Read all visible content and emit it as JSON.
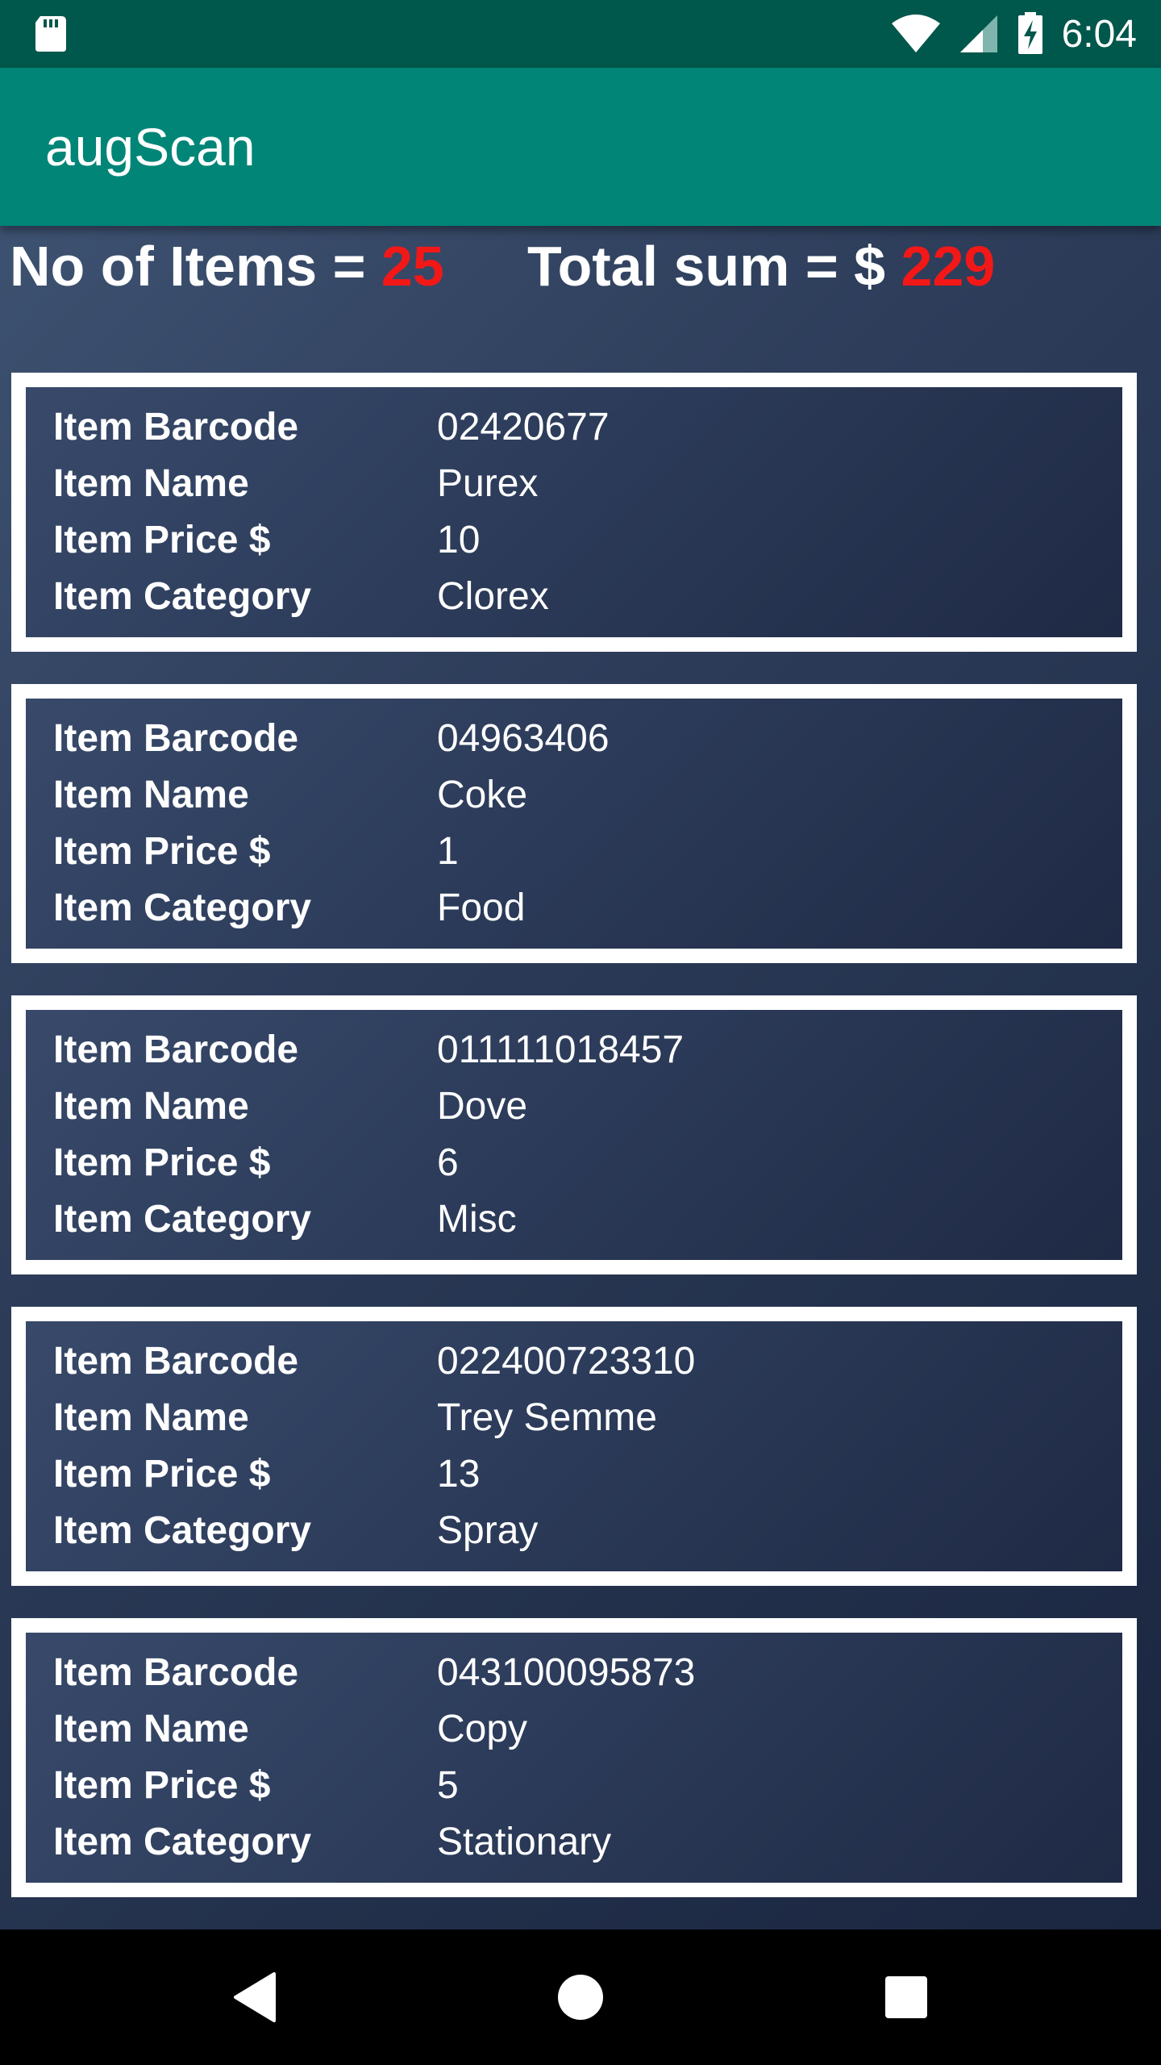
{
  "status_bar": {
    "time": "6:04",
    "icons": [
      "sd-card-icon",
      "wifi-icon",
      "cell-signal-icon",
      "battery-charging-icon"
    ]
  },
  "app_bar": {
    "title": "augScan"
  },
  "summary": {
    "items_label": "No of Items = ",
    "items_count": "25",
    "total_label": "Total sum = $ ",
    "total_value": "229"
  },
  "items": [
    {
      "barcode_label": "Item Barcode",
      "barcode": "02420677",
      "name_label": "Item Name",
      "name": "Purex",
      "price_label": "Item Price $",
      "price": "10",
      "category_label": "Item Category",
      "category": "Clorex"
    },
    {
      "barcode_label": "Item Barcode",
      "barcode": "04963406",
      "name_label": "Item Name",
      "name": "Coke",
      "price_label": "Item Price $",
      "price": "1",
      "category_label": "Item Category",
      "category": "Food"
    },
    {
      "barcode_label": "Item Barcode",
      "barcode": "011111018457",
      "name_label": "Item Name",
      "name": "Dove",
      "price_label": "Item Price $",
      "price": "6",
      "category_label": "Item Category",
      "category": "Misc"
    },
    {
      "barcode_label": "Item Barcode",
      "barcode": "022400723310",
      "name_label": "Item Name",
      "name": "Trey Semme",
      "price_label": "Item Price $",
      "price": "13",
      "category_label": "Item Category",
      "category": "Spray"
    },
    {
      "barcode_label": "Item Barcode",
      "barcode": "043100095873",
      "name_label": "Item Name",
      "name": "Copy",
      "price_label": "Item Price $",
      "price": "5",
      "category_label": "Item Category",
      "category": "Stationary"
    }
  ],
  "nav_bar": {
    "buttons": [
      "back-icon",
      "home-icon",
      "recents-icon"
    ]
  },
  "colors": {
    "status_bar": "#00574b",
    "app_bar": "#008577",
    "highlight": "#f21818"
  }
}
